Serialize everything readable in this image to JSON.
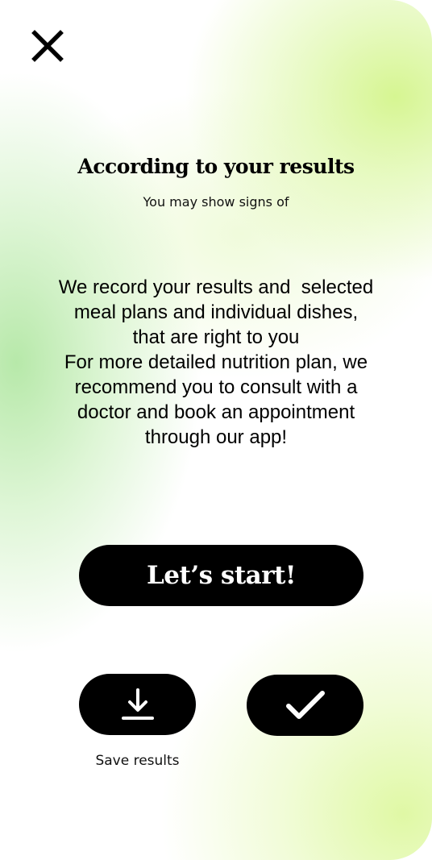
{
  "header": {
    "close_icon": "close-icon"
  },
  "results": {
    "title": "According to your results",
    "subtitle": "You may show signs of"
  },
  "message": {
    "lines": [
      "We record your results and  selected",
      "meal plans and individual dishes,",
      "that are right to you",
      "For more detailed nutrition plan, we",
      "recommend you to consult with a",
      "doctor and book an appointment",
      "through our app!"
    ]
  },
  "actions": {
    "start_label": "Let’s start!",
    "save_icon": "download-icon",
    "save_label": "Save results",
    "confirm_icon": "checkmark-icon"
  },
  "colors": {
    "button_bg": "#000000",
    "button_fg": "#ffffff",
    "accent_green": "#d4f58c"
  }
}
